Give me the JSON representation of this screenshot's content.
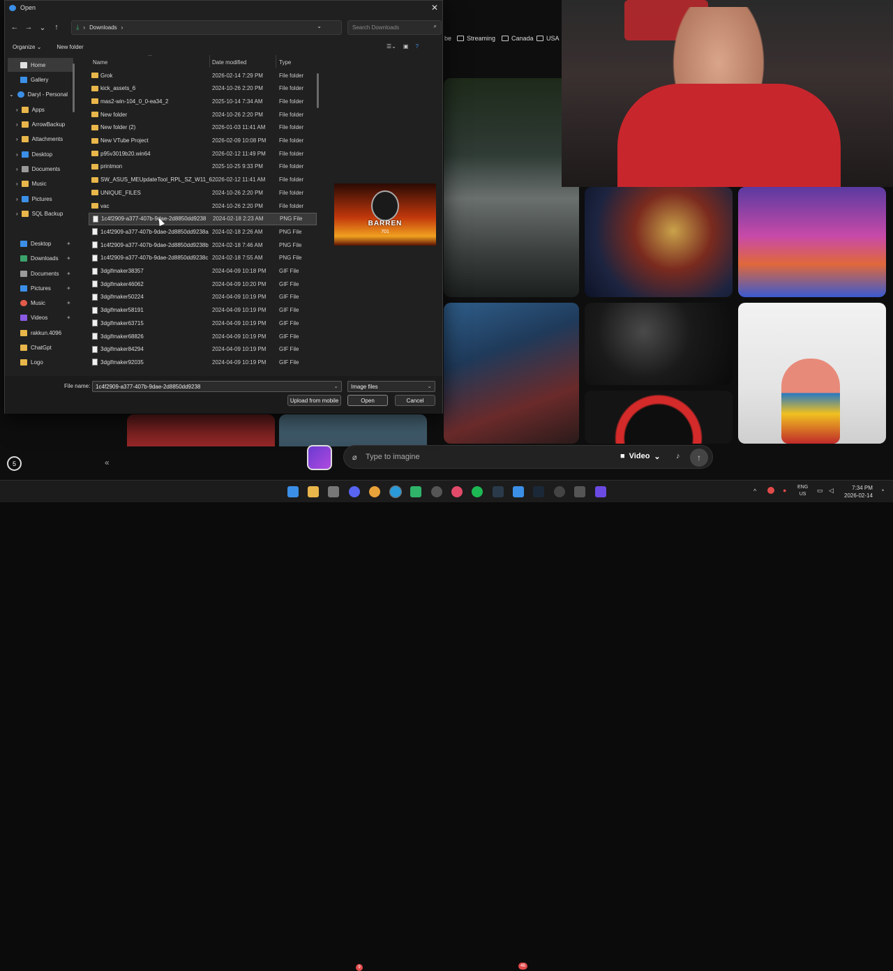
{
  "dialog": {
    "title": "Open",
    "breadcrumb": "Downloads",
    "search_placeholder": "Search Downloads",
    "toolbar": {
      "organize": "Organize",
      "new_folder": "New folder"
    },
    "columns": {
      "name": "Name",
      "date": "Date modified",
      "type": "Type"
    },
    "nav": [
      {
        "label": "Home",
        "icon": "home-icon",
        "color": "#e0e0e0"
      },
      {
        "label": "Gallery",
        "icon": "gallery-icon",
        "color": "#3b8fe6"
      },
      {
        "label": "Daryl - Personal",
        "icon": "cloud-icon",
        "color": "#3b8fe6"
      },
      {
        "label": "Apps",
        "icon": "folder-icon",
        "color": "#e8b64a"
      },
      {
        "label": "ArrowBackup",
        "icon": "folder-icon",
        "color": "#e8b64a"
      },
      {
        "label": "Attachments",
        "icon": "folder-icon",
        "color": "#e8b64a"
      },
      {
        "label": "Desktop",
        "icon": "desktop-icon",
        "color": "#3b8fe6"
      },
      {
        "label": "Documents",
        "icon": "documents-icon",
        "color": "#9a9a9a"
      },
      {
        "label": "Music",
        "icon": "folder-icon",
        "color": "#e8b64a"
      },
      {
        "label": "Pictures",
        "icon": "pictures-icon",
        "color": "#3b8fe6"
      },
      {
        "label": "SQL Backup",
        "icon": "folder-icon",
        "color": "#e8b64a"
      },
      {
        "label": "Desktop",
        "icon": "desktop-icon",
        "color": "#3b8fe6"
      },
      {
        "label": "Downloads",
        "icon": "download-icon",
        "color": "#3ba26c"
      },
      {
        "label": "Documents",
        "icon": "documents-icon",
        "color": "#9a9a9a"
      },
      {
        "label": "Pictures",
        "icon": "pictures-icon",
        "color": "#3b8fe6"
      },
      {
        "label": "Music",
        "icon": "music-icon",
        "color": "#e25a4a"
      },
      {
        "label": "Videos",
        "icon": "videos-icon",
        "color": "#8a5ae2"
      },
      {
        "label": "rakkun.4096",
        "icon": "folder-icon",
        "color": "#e8b64a"
      },
      {
        "label": "ChatGpt",
        "icon": "folder-icon",
        "color": "#e8b64a"
      },
      {
        "label": "Logo",
        "icon": "folder-icon",
        "color": "#e8b64a"
      }
    ],
    "files": [
      {
        "name": "Grok",
        "date": "2026-02-14 7:29 PM",
        "type": "File folder",
        "kind": "folder"
      },
      {
        "name": "kick_assets_6",
        "date": "2024-10-26 2:20 PM",
        "type": "File folder",
        "kind": "folder"
      },
      {
        "name": "mas2-win-104_0_0-ea34_2",
        "date": "2025-10-14 7:34 AM",
        "type": "File folder",
        "kind": "folder"
      },
      {
        "name": "New folder",
        "date": "2024-10-26 2:20 PM",
        "type": "File folder",
        "kind": "folder"
      },
      {
        "name": "New folder (2)",
        "date": "2026-01-03 11:41 AM",
        "type": "File folder",
        "kind": "folder"
      },
      {
        "name": "New VTube Project",
        "date": "2026-02-09 10:08 PM",
        "type": "File folder",
        "kind": "folder"
      },
      {
        "name": "p95v3019b20.win64",
        "date": "2026-02-12 11:49 PM",
        "type": "File folder",
        "kind": "folder"
      },
      {
        "name": "printmon",
        "date": "2025-10-25 9:33 PM",
        "type": "File folder",
        "kind": "folder"
      },
      {
        "name": "SW_ASUS_MEUpdateTool_RPL_SZ_W11_6...",
        "date": "2026-02-12 11:41 AM",
        "type": "File folder",
        "kind": "folder"
      },
      {
        "name": "UNIQUE_FILES",
        "date": "2024-10-26 2:20 PM",
        "type": "File folder",
        "kind": "folder"
      },
      {
        "name": "vac",
        "date": "2024-10-26 2:20 PM",
        "type": "File folder",
        "kind": "folder"
      },
      {
        "name": "1c4f2909-a377-407b-9dae-2d8850dd9238",
        "date": "2024-02-18 2:23 AM",
        "type": "PNG File",
        "kind": "file",
        "selected": true
      },
      {
        "name": "1c4f2909-a377-407b-9dae-2d8850dd9238a",
        "date": "2024-02-18 2:26 AM",
        "type": "PNG File",
        "kind": "file"
      },
      {
        "name": "1c4f2909-a377-407b-9dae-2d8850dd9238b",
        "date": "2024-02-18 7:46 AM",
        "type": "PNG File",
        "kind": "file"
      },
      {
        "name": "1c4f2909-a377-407b-9dae-2d8850dd9238c",
        "date": "2024-02-18 7:55 AM",
        "type": "PNG File",
        "kind": "file"
      },
      {
        "name": "3dgifmaker38357",
        "date": "2024-04-09 10:18 PM",
        "type": "GIF File",
        "kind": "file"
      },
      {
        "name": "3dgifmaker46062",
        "date": "2024-04-09 10:20 PM",
        "type": "GIF File",
        "kind": "file"
      },
      {
        "name": "3dgifmaker50224",
        "date": "2024-04-09 10:19 PM",
        "type": "GIF File",
        "kind": "file"
      },
      {
        "name": "3dgifmaker58191",
        "date": "2024-04-09 10:19 PM",
        "type": "GIF File",
        "kind": "file"
      },
      {
        "name": "3dgifmaker63715",
        "date": "2024-04-09 10:19 PM",
        "type": "GIF File",
        "kind": "file"
      },
      {
        "name": "3dgifmaker68826",
        "date": "2024-04-09 10:19 PM",
        "type": "GIF File",
        "kind": "file"
      },
      {
        "name": "3dgifmaker84294",
        "date": "2024-04-09 10:19 PM",
        "type": "GIF File",
        "kind": "file"
      },
      {
        "name": "3dgifmaker92035",
        "date": "2024-04-09 10:19 PM",
        "type": "GIF File",
        "kind": "file"
      }
    ],
    "preview_text": {
      "name": "BARREN",
      "number": "701"
    },
    "file_name_label": "File name:",
    "file_name_value": "1c4f2909-a377-407b-9dae-2d8850dd9238",
    "file_type": "Image files",
    "buttons": {
      "upload": "Upload from mobile",
      "open": "Open",
      "cancel": "Cancel"
    }
  },
  "background": {
    "bookmarks": [
      "be",
      "Streaming",
      "Canada",
      "USA"
    ],
    "prompt_placeholder": "Type to imagine",
    "mode_label": "Video",
    "badge_number": "5"
  },
  "taskbar": {
    "language": "ENG",
    "region": "US",
    "time": "7:34 PM",
    "date": "2026-02-14",
    "badge_a": "9",
    "badge_b": "46"
  }
}
